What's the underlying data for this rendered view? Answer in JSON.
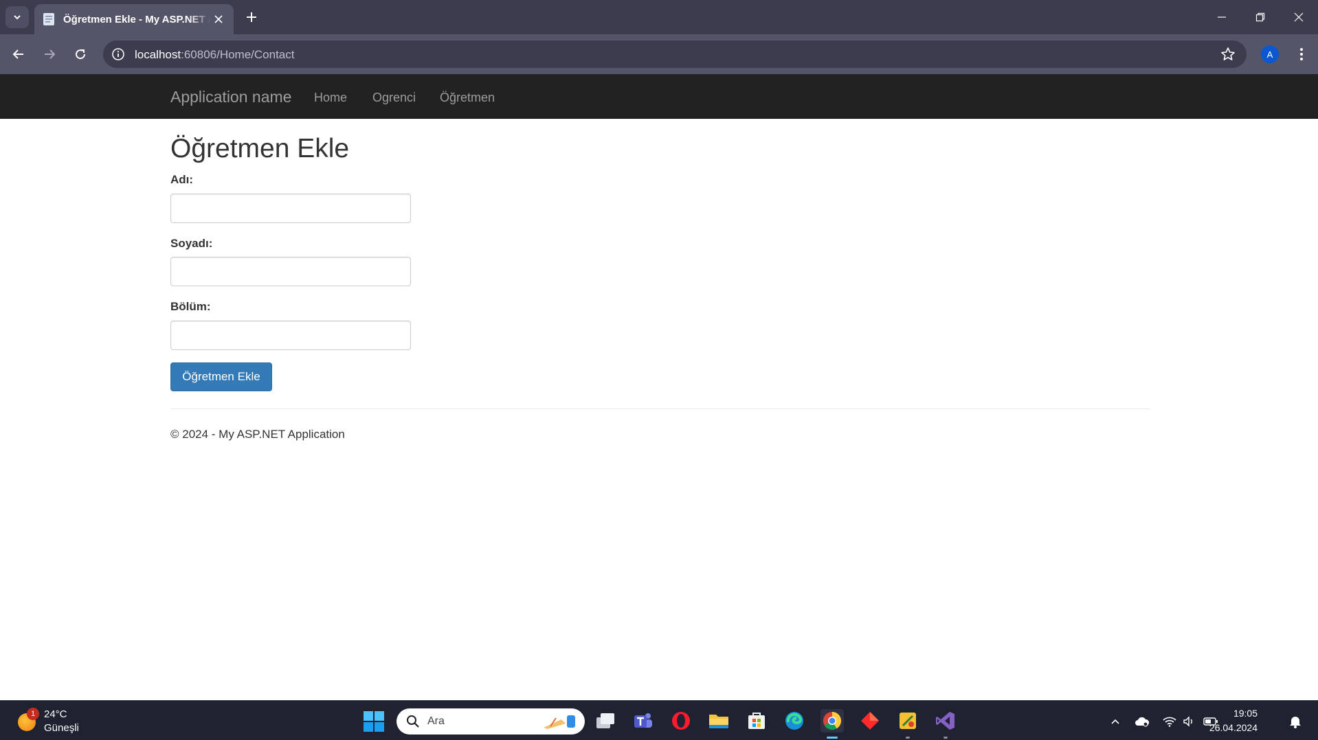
{
  "browser": {
    "tab_title": "Öğretmen Ekle - My ASP.NET Application",
    "url_host": "localhost",
    "url_path": ":60806/Home/Contact",
    "profile_initial": "A"
  },
  "navbar": {
    "brand": "Application name",
    "links": [
      "Home",
      "Ogrenci",
      "Öğretmen"
    ]
  },
  "form": {
    "title": "Öğretmen Ekle",
    "fields": [
      {
        "label": "Adı:",
        "value": ""
      },
      {
        "label": "Soyadı:",
        "value": ""
      },
      {
        "label": "Bölüm:",
        "value": ""
      }
    ],
    "submit_label": "Öğretmen Ekle"
  },
  "footer": {
    "text": "© 2024 - My ASP.NET Application"
  },
  "taskbar": {
    "weather_temp": "24°C",
    "weather_condition": "Güneşli",
    "weather_badge": "1",
    "search_placeholder": "Ara",
    "time": "19:05",
    "date": "26.04.2024",
    "apps": [
      "task-view-icon",
      "teams-icon",
      "opera-icon",
      "file-explorer-icon",
      "microsoft-store-icon",
      "edge-icon",
      "chrome-icon",
      "git-icon",
      "app-icon",
      "visual-studio-icon"
    ]
  },
  "colors": {
    "navbar_bg": "#222222",
    "primary_button": "#337ab7",
    "browser_frame": "#3c3c4e"
  }
}
